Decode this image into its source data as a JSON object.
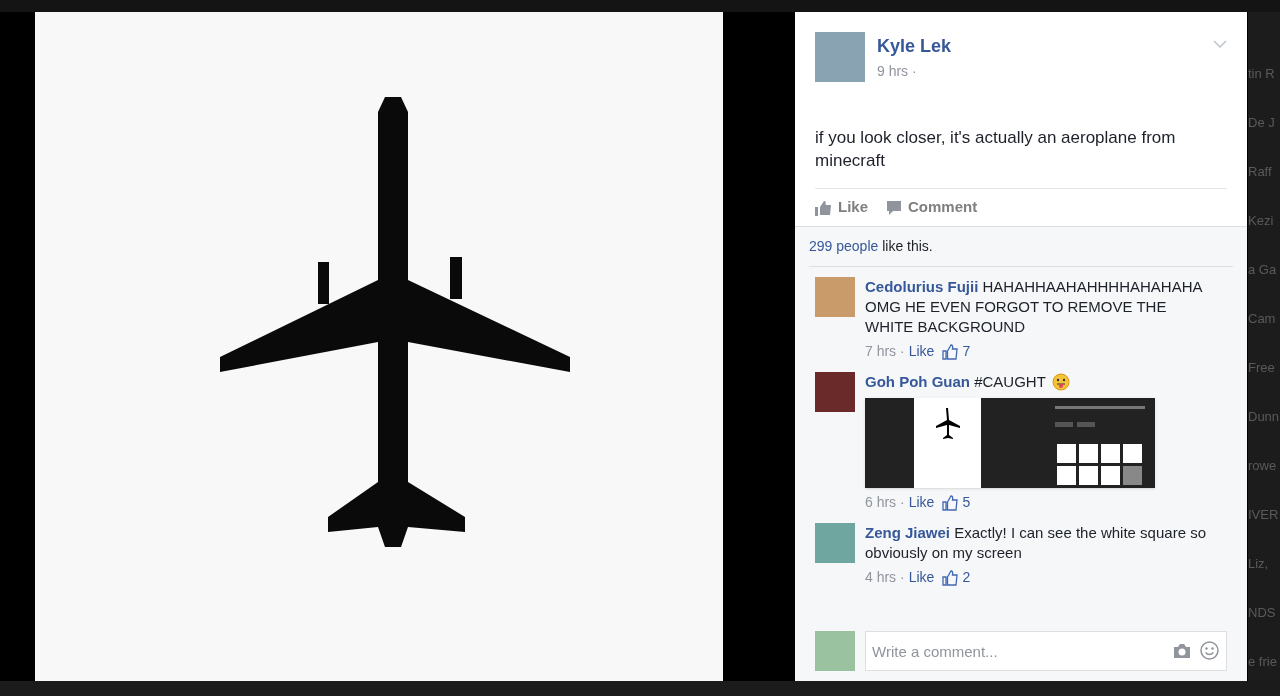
{
  "background_sidebar": {
    "items": [
      "tin R",
      "De J",
      "Raff",
      "Kezi",
      "a Ga",
      "Cam",
      "Free",
      "Dunn",
      "rowe",
      "IVER",
      "Liz,",
      "NDS",
      "e frie"
    ]
  },
  "post": {
    "author": "Kyle Lek",
    "time": "9 hrs ·",
    "text": "if you look closer, it's actually an aeroplane from minecraft",
    "actions": [
      {
        "kind": "like",
        "label": "Like"
      },
      {
        "kind": "comment",
        "label": "Comment"
      }
    ]
  },
  "likes": {
    "link": "299 people",
    "text": "like this."
  },
  "comments": [
    {
      "kind": "text",
      "author": "Cedolurius Fujii",
      "text": "HAHAHHAAHAHHHHAHAHAHA OMG HE EVEN FORGOT TO REMOVE THE WHITE BACKGROUND",
      "time": "7 hrs ·",
      "like": "Like",
      "like_count": "7"
    },
    {
      "kind": "image",
      "author": "Goh Poh Guan",
      "text": "#CAUGHT",
      "time": "6 hrs ·",
      "like": "Like",
      "like_count": "5"
    },
    {
      "kind": "text",
      "author": "Zeng Jiawei",
      "text": "Exactly! I can see the white square so obviously on my screen",
      "time": "4 hrs ·",
      "like": "Like",
      "like_count": "2"
    }
  ],
  "comment_box": {
    "placeholder": "Write a comment..."
  }
}
